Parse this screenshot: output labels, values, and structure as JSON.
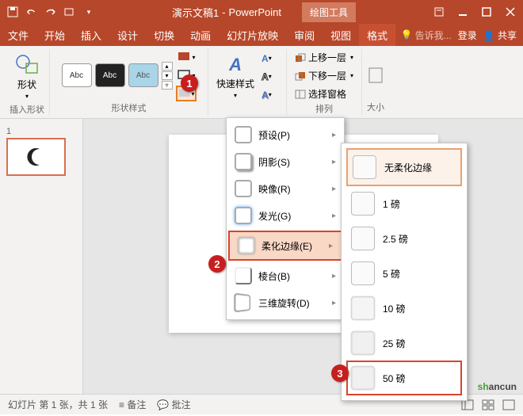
{
  "title": {
    "doc": "演示文稿1",
    "sep": " - ",
    "app": "PowerPoint",
    "context": "绘图工具"
  },
  "tabs": {
    "file": "文件",
    "home": "开始",
    "insert": "插入",
    "design": "设计",
    "trans": "切换",
    "anim": "动画",
    "slideshow": "幻灯片放映",
    "review": "审阅",
    "view": "视图",
    "format": "格式"
  },
  "tellme": "告诉我...",
  "signin": "登录",
  "share": "共享",
  "ribbon": {
    "insertShape": "插入形状",
    "shapes": "形状",
    "shapeStyles": "形状样式",
    "abc": "Abc",
    "quickStyles": "快速样式",
    "bringForward": "上移一层",
    "sendBackward": "下移一层",
    "selectionPane": "选择窗格",
    "arrange": "排列",
    "size": "大小"
  },
  "thumb": {
    "num": "1"
  },
  "menu": {
    "preset": "预设(P)",
    "shadow": "阴影(S)",
    "reflection": "映像(R)",
    "glow": "发光(G)",
    "softEdges": "柔化边缘(E)",
    "bevel": "棱台(B)",
    "rotation3d": "三维旋转(D)"
  },
  "submenu": {
    "none": "无柔化边缘",
    "p1": "1 磅",
    "p2_5": "2.5 磅",
    "p5": "5 磅",
    "p10": "10 磅",
    "p25": "25 磅",
    "p50": "50 磅"
  },
  "callouts": {
    "c1": "1",
    "c2": "2",
    "c3": "3"
  },
  "status": {
    "slide": "幻灯片 第 1 张，共 1 张",
    "notes": "备注",
    "comments": "批注"
  },
  "watermark": {
    "part1": "sh",
    "part2": "ancun"
  }
}
